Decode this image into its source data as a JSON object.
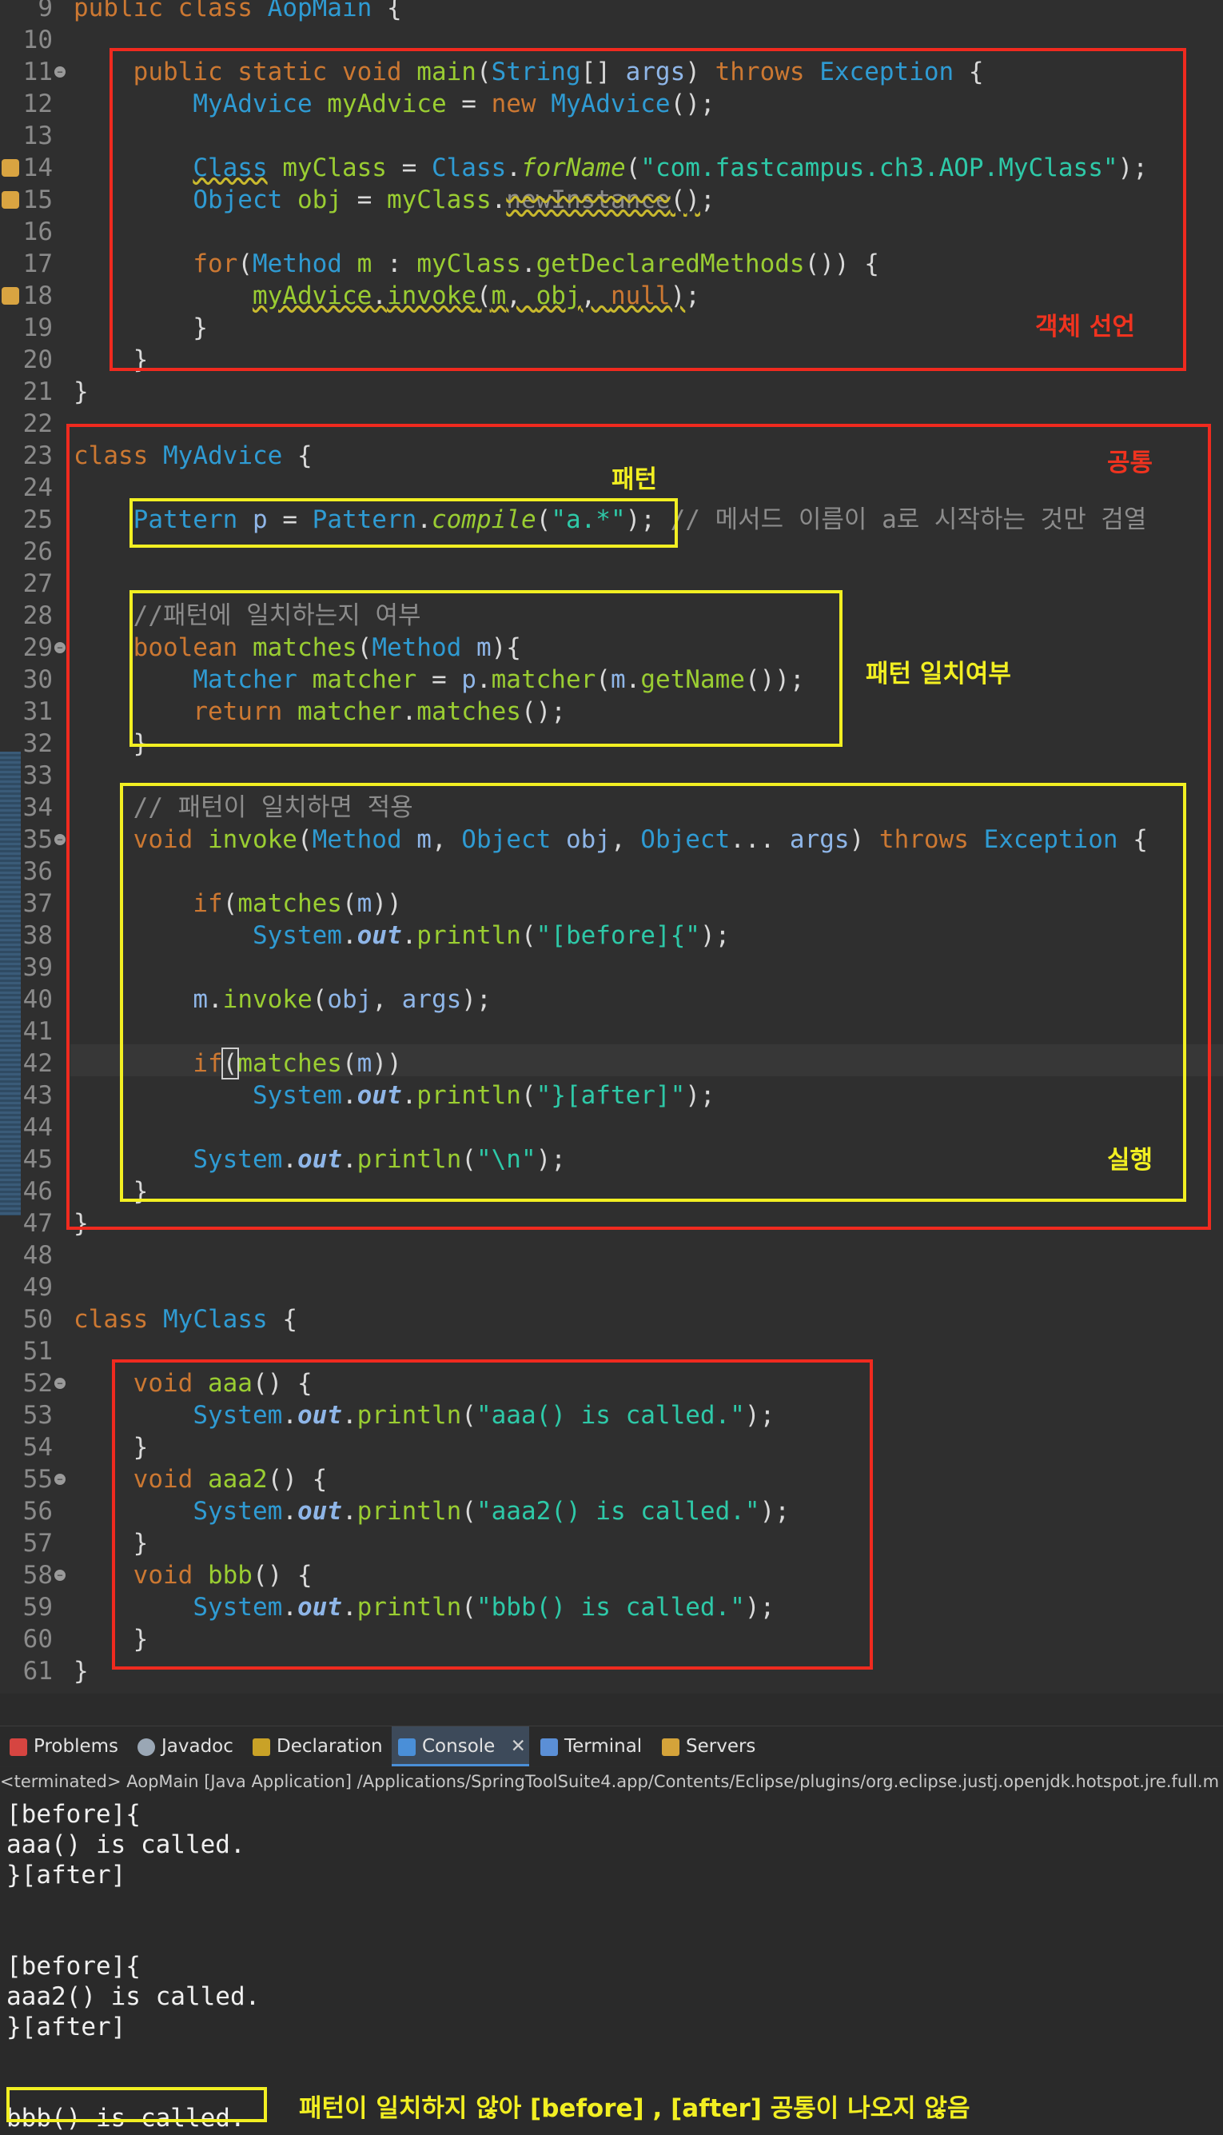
{
  "editor": {
    "lines": [
      {
        "n": "9",
        "html": "<span class='kw'>public</span> <span class='kw'>class</span> <span class='ty'>AopMain</span> {"
      },
      {
        "n": "10",
        "html": ""
      },
      {
        "n": "11",
        "html": "    <span class='kw'>public static void</span> <span class='fn'>main</span>(<span class='ty'>String</span>[] <span class='vr'>args</span>) <span class='kw'>throws</span> <span class='ty'>Exception</span> {"
      },
      {
        "n": "12",
        "html": "        <span class='ty'>MyAdvice</span> <span class='fn'>myAdvice</span> = <span class='kw'>new</span> <span class='ty'>MyAdvice</span>();"
      },
      {
        "n": "13",
        "html": ""
      },
      {
        "n": "14",
        "html": "        <span class='ty wv'>Class</span> <span class='fn'>myClass</span> = <span class='ty'>Class</span>.<span class='fn it'>forName</span>(<span class='st'>\"com.fastcampus.ch3.AOP.MyClass\"</span>);"
      },
      {
        "n": "15",
        "html": "        <span class='ty'>Object</span> <span class='fn'>obj</span> = <span class='fn'>myClass</span>.<span class='cm wv' style='text-decoration-line:underline line-through'>newInstance</span><span class='wv'>()</span>;"
      },
      {
        "n": "16",
        "html": ""
      },
      {
        "n": "17",
        "html": "        <span class='kw'>for</span>(<span class='ty'>Method</span> <span class='fn'>m</span> : <span class='fn'>myClass</span>.<span class='fn'>getDeclaredMethods</span>()) {"
      },
      {
        "n": "18",
        "html": "            <span class='wv'><span class='fn'>myAdvice</span>.<span class='fn'>invoke</span>(<span class='fn'>m</span>, <span class='fn'>obj</span>, <span class='kw'>null</span>)</span>;"
      },
      {
        "n": "19",
        "html": "        }"
      },
      {
        "n": "20",
        "html": "    }"
      },
      {
        "n": "21",
        "html": "}"
      },
      {
        "n": "22",
        "html": ""
      },
      {
        "n": "23",
        "html": "<span class='kw'>class</span> <span class='ty'>MyAdvice</span> {"
      },
      {
        "n": "24",
        "html": ""
      },
      {
        "n": "25",
        "html": "    <span class='ty'>Pattern</span> <span class='vr'>p</span> = <span class='ty'>Pattern</span>.<span class='fn it'>compile</span>(<span class='st'>\"a.*\"</span>); <span class='cm'>// 메서드 이름이 a로 시작하는 것만 검열</span>"
      },
      {
        "n": "26",
        "html": ""
      },
      {
        "n": "27",
        "html": ""
      },
      {
        "n": "28",
        "html": "    <span class='cm'>//패턴에 일치하는지 여부</span>"
      },
      {
        "n": "29",
        "html": "    <span class='kw'>boolean</span> <span class='fn'>matches</span>(<span class='ty'>Method</span> <span class='vr'>m</span>){"
      },
      {
        "n": "30",
        "html": "        <span class='ty'>Matcher</span> <span class='fn'>matcher</span> = <span class='vr'>p</span>.<span class='fn'>matcher</span>(<span class='vr'>m</span>.<span class='fn'>getName</span>());"
      },
      {
        "n": "31",
        "html": "        <span class='kw'>return</span> <span class='fn'>matcher</span>.<span class='fn'>matches</span>();"
      },
      {
        "n": "32",
        "html": "    }"
      },
      {
        "n": "33",
        "html": ""
      },
      {
        "n": "34",
        "html": "    <span class='cm'>// 패턴이 일치하면 적용</span>"
      },
      {
        "n": "35",
        "html": "    <span class='kw'>void</span> <span class='fn'>invoke</span>(<span class='ty'>Method</span> <span class='vr'>m</span>, <span class='ty'>Object</span> <span class='vr'>obj</span>, <span class='ty'>Object</span>... <span class='vr'>args</span>) <span class='kw'>throws</span> <span class='ty'>Exception</span> {"
      },
      {
        "n": "36",
        "html": ""
      },
      {
        "n": "37",
        "html": "        <span class='kw'>if</span>(<span class='fn'>matches</span>(<span class='vr'>m</span>))"
      },
      {
        "n": "38",
        "html": "            <span class='ty'>System</span>.<span class='vr bo'>out</span>.<span class='fn'>println</span>(<span class='st'>\"[before]{\"</span>);"
      },
      {
        "n": "39",
        "html": ""
      },
      {
        "n": "40",
        "html": "        <span class='vr'>m</span>.<span class='fn'>invoke</span>(<span class='vr'>obj</span>, <span class='vr'>args</span>);"
      },
      {
        "n": "41",
        "html": ""
      },
      {
        "n": "42",
        "html": "        <span class='kw'>if</span><span style='outline:2px solid #cfcfcf'>(</span><span class='fn'>matches</span>(<span class='vr'>m</span>))"
      },
      {
        "n": "43",
        "html": "            <span class='ty'>System</span>.<span class='vr bo'>out</span>.<span class='fn'>println</span>(<span class='st'>\"}[after]\"</span>);"
      },
      {
        "n": "44",
        "html": ""
      },
      {
        "n": "45",
        "html": "        <span class='ty'>System</span>.<span class='vr bo'>out</span>.<span class='fn'>println</span>(<span class='st'>\"\\n\"</span>);"
      },
      {
        "n": "46",
        "html": "    }"
      },
      {
        "n": "47",
        "html": "}"
      },
      {
        "n": "48",
        "html": ""
      },
      {
        "n": "49",
        "html": ""
      },
      {
        "n": "50",
        "html": "<span class='kw'>class</span> <span class='ty'>MyClass</span> {"
      },
      {
        "n": "51",
        "html": ""
      },
      {
        "n": "52",
        "html": "    <span class='kw'>void</span> <span class='fn'>aaa</span>() {"
      },
      {
        "n": "53",
        "html": "        <span class='ty'>System</span>.<span class='vr bo'>out</span>.<span class='fn'>println</span>(<span class='st'>\"aaa() is called.\"</span>);"
      },
      {
        "n": "54",
        "html": "    }"
      },
      {
        "n": "55",
        "html": "    <span class='kw'>void</span> <span class='fn'>aaa2</span>() {"
      },
      {
        "n": "56",
        "html": "        <span class='ty'>System</span>.<span class='vr bo'>out</span>.<span class='fn'>println</span>(<span class='st'>\"aaa2() is called.\"</span>);"
      },
      {
        "n": "57",
        "html": "    }"
      },
      {
        "n": "58",
        "html": "    <span class='kw'>void</span> <span class='fn'>bbb</span>() {"
      },
      {
        "n": "59",
        "html": "        <span class='ty'>System</span>.<span class='vr bo'>out</span>.<span class='fn'>println</span>(<span class='st'>\"bbb() is called.\"</span>);"
      },
      {
        "n": "60",
        "html": "    }"
      },
      {
        "n": "61",
        "html": "}"
      }
    ],
    "fold_lines": [
      "11",
      "29",
      "35",
      "52",
      "55",
      "58"
    ],
    "warning_lines": [
      "14",
      "15",
      "18"
    ]
  },
  "annotations": {
    "object_decl": "객체 선언",
    "common": "공통",
    "pattern": "패턴",
    "pattern_match": "패턴 일치여부",
    "execute": "실행",
    "console_note": "패턴이 일치하지 않아 [before] , [after] 공통이 나오지 않음"
  },
  "tabs": [
    {
      "label": "Problems",
      "icon": "problems-icon",
      "color": "#d64541"
    },
    {
      "label": "Javadoc",
      "icon": "javadoc-icon",
      "color": "#9aa7b5"
    },
    {
      "label": "Declaration",
      "icon": "declaration-icon",
      "color": "#c9a227"
    },
    {
      "label": "Console",
      "icon": "console-icon",
      "color": "#4a8fd8",
      "active": true
    },
    {
      "label": "Terminal",
      "icon": "terminal-icon",
      "color": "#5b8fd6"
    },
    {
      "label": "Servers",
      "icon": "servers-icon",
      "color": "#d4a33a"
    }
  ],
  "console": {
    "header": "<terminated> AopMain [Java Application] /Applications/SpringToolSuite4.app/Contents/Eclipse/plugins/org.eclipse.justj.openjdk.hotspot.jre.full.m",
    "lines": [
      "[before]{",
      "aaa() is called.",
      "}[after]",
      "",
      "",
      "[before]{",
      "aaa2() is called.",
      "}[after]",
      "",
      "",
      "bbb() is called."
    ]
  },
  "colors": {
    "red_box": "#f02a1f",
    "yellow_box": "#f2ef22",
    "active_tab": "#3d4a5a"
  }
}
